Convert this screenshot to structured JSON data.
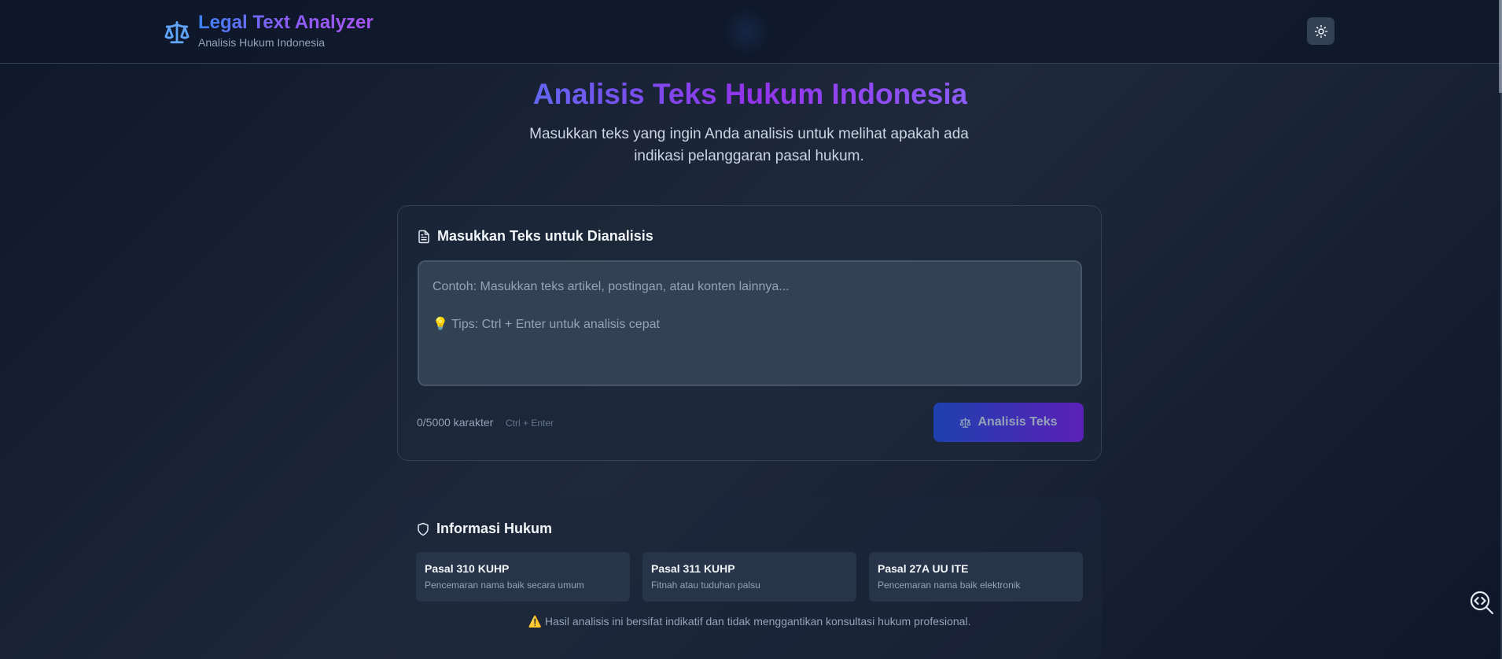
{
  "header": {
    "title": "Legal Text Analyzer",
    "subtitle": "Analisis Hukum Indonesia",
    "brand_icon": "scale-icon",
    "theme_icon": "sun-icon"
  },
  "hero": {
    "title": "Analisis Teks Hukum Indonesia",
    "description": "Masukkan teks yang ingin Anda analisis untuk melihat apakah ada indikasi pelanggaran pasal hukum."
  },
  "input_card": {
    "title": "Masukkan Teks untuk Dianalisis",
    "icon": "document-icon",
    "textarea_value": "",
    "textarea_placeholder": "Contoh: Masukkan teks artikel, postingan, atau konten lainnya...\n\n💡 Tips: Ctrl + Enter untuk analisis cepat",
    "char_count": "0/5000 karakter",
    "shortcut_hint": "Ctrl + Enter",
    "analyze_label": "Analisis Teks"
  },
  "info": {
    "title": "Informasi Hukum",
    "icon": "shield-icon",
    "laws": [
      {
        "name": "Pasal 310 KUHP",
        "desc": "Pencemaran nama baik secara umum"
      },
      {
        "name": "Pasal 311 KUHP",
        "desc": "Fitnah atau tuduhan palsu"
      },
      {
        "name": "Pasal 27A UU ITE",
        "desc": "Pencemaran nama baik elektronik"
      }
    ],
    "disclaimer": "⚠️ Hasil analisis ini bersifat indikatif dan tidak menggantikan konsultasi hukum profesional."
  },
  "colors": {
    "accent_blue": "#3b82f6",
    "accent_purple": "#8b5cf6",
    "background": "#0f172a"
  }
}
